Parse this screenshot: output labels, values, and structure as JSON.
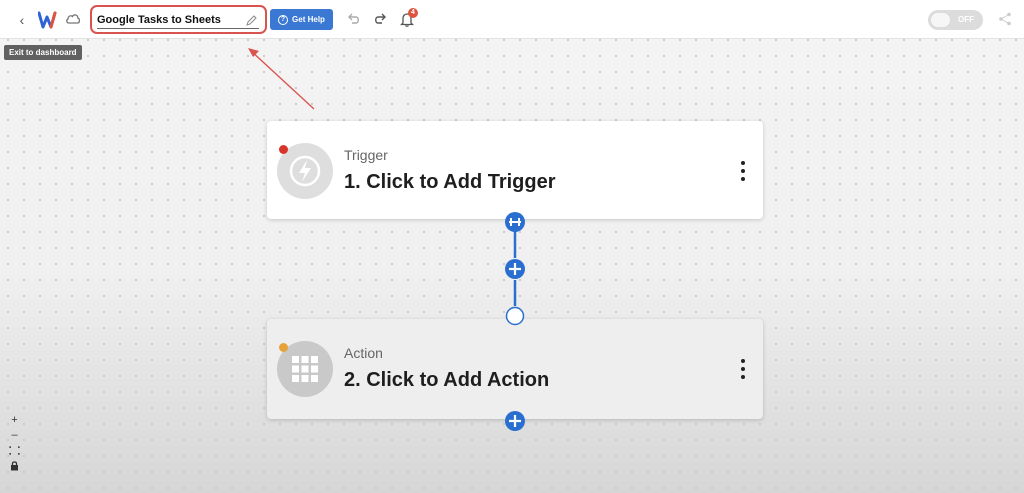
{
  "topbar": {
    "back_tooltip": "Exit to dashboard",
    "workflow_name": "Google Tasks to Sheets",
    "help_label": "Get Help",
    "notification_count": "4",
    "toggle_label": "OFF"
  },
  "steps": [
    {
      "kind": "Trigger",
      "title": "1. Click to Add Trigger",
      "status_color": "#d9342b",
      "icon": "lightning-bolt-icon"
    },
    {
      "kind": "Action",
      "title": "2. Click to Add Action",
      "status_color": "#e8a23a",
      "icon": "app-grid-icon"
    }
  ],
  "colors": {
    "accent_blue": "#2a6fd0",
    "annotation_red": "#d9534f"
  }
}
